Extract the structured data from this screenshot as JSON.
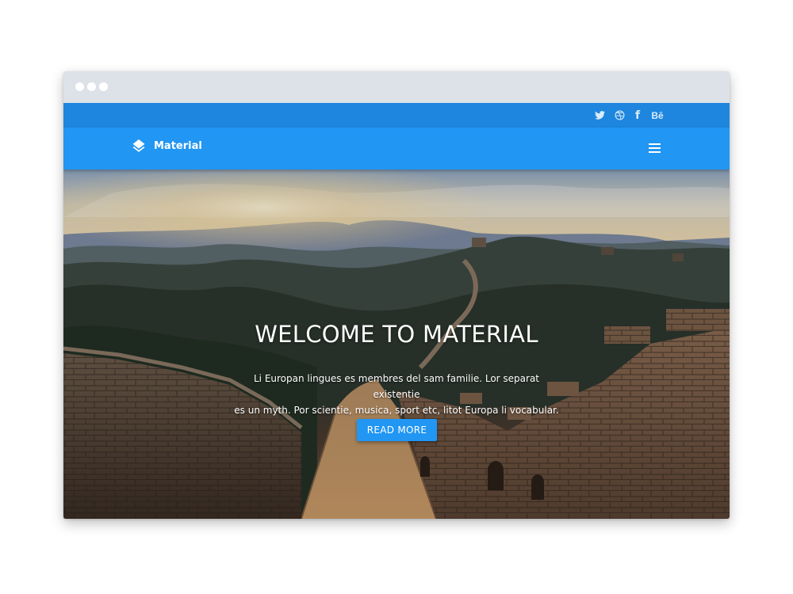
{
  "browser": {
    "window_dots": [
      "close",
      "minimize",
      "maximize"
    ]
  },
  "topbar": {
    "social": [
      {
        "name": "twitter-icon",
        "glyph": "twitter"
      },
      {
        "name": "dribbble-icon",
        "glyph": "dribbble"
      },
      {
        "name": "facebook-icon",
        "glyph": "f"
      },
      {
        "name": "behance-icon",
        "glyph": "Bē"
      }
    ]
  },
  "navbar": {
    "brand": "Material",
    "brand_icon": "layers-icon",
    "menu_icon": "hamburger-menu-icon"
  },
  "hero": {
    "title": "WELCOME TO MATERIAL",
    "text_line1": "Li Europan lingues es membres del sam familie. Lor separat existentie",
    "text_line2": "es un myth. Por scientie, musica, sport etc, litot Europa li vocabular.",
    "button_label": "READ MORE"
  },
  "colors": {
    "primary": "#2196f3",
    "topbar": "#1e86de",
    "chrome": "#dde2e8"
  }
}
